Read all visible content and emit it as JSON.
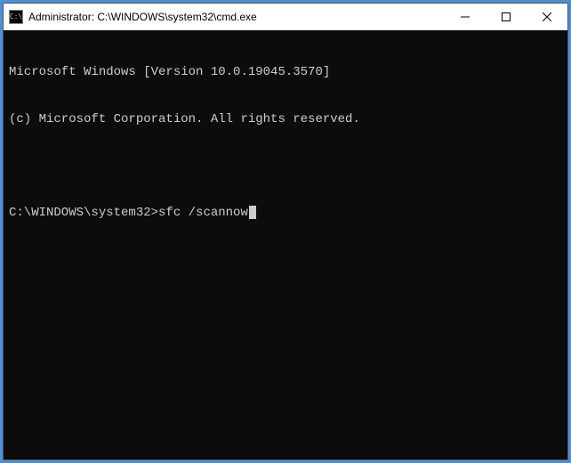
{
  "window": {
    "title": "Administrator: C:\\WINDOWS\\system32\\cmd.exe",
    "icon_glyph": "C:\\"
  },
  "terminal": {
    "header_line1": "Microsoft Windows [Version 10.0.19045.3570]",
    "header_line2": "(c) Microsoft Corporation. All rights reserved.",
    "prompt": "C:\\WINDOWS\\system32>",
    "command": "sfc /scannow"
  }
}
